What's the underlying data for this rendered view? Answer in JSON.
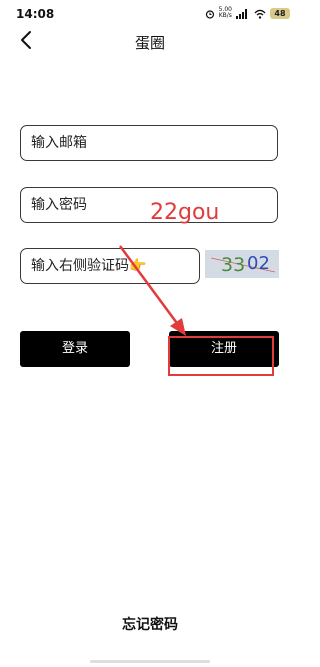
{
  "status_bar": {
    "time": "14:08",
    "net_speed": "5.00\nKB/s",
    "signal_label": "5G",
    "battery": "48"
  },
  "nav": {
    "title": "蛋圈",
    "back_icon": "chevron-left-icon"
  },
  "form": {
    "email_placeholder": "输入邮箱",
    "password_placeholder": "输入密码",
    "captcha_placeholder": "输入右侧验证码",
    "captcha_emoji": "👉",
    "captcha_text_left": "33",
    "captcha_text_right": "02"
  },
  "buttons": {
    "login": "登录",
    "register": "注册"
  },
  "overlay": {
    "watermark": "22gou",
    "arrow_color": "#e23b3b"
  },
  "footer": {
    "forgot_password": "忘记密码"
  }
}
